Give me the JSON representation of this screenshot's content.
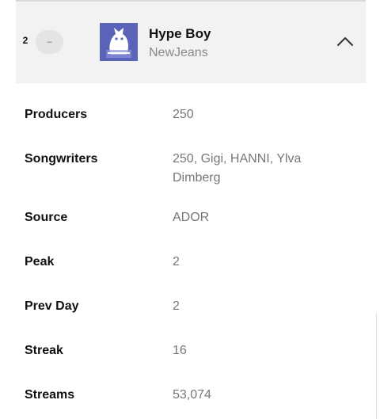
{
  "track": {
    "rank": "2",
    "change": "–",
    "title": "Hype Boy",
    "artist": "NewJeans"
  },
  "details": [
    {
      "label": "Producers",
      "value": "250"
    },
    {
      "label": "Songwriters",
      "value": "250, Gigi, HANNI, Ylva Dimberg"
    },
    {
      "label": "Source",
      "value": "ADOR"
    },
    {
      "label": "Peak",
      "value": "2"
    },
    {
      "label": "Prev Day",
      "value": "2"
    },
    {
      "label": "Streak",
      "value": "16"
    },
    {
      "label": "Streams",
      "value": "53,074"
    }
  ],
  "colors": {
    "header_bg": "#f2f2f2",
    "cover": "#5a63b8",
    "value_text": "#777777"
  },
  "icons": {
    "collapse": "chevron-up-icon"
  }
}
